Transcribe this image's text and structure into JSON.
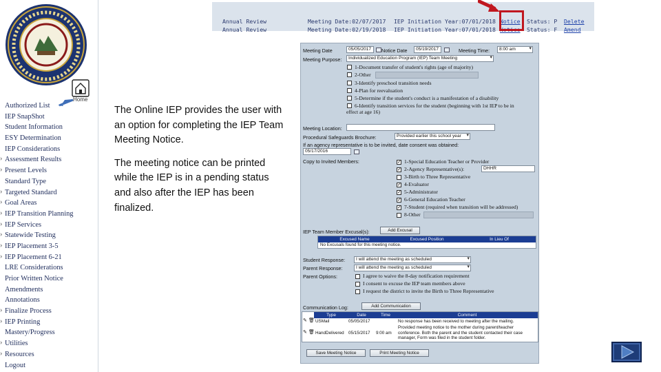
{
  "sidebar": {
    "home_label": "Home",
    "items": [
      {
        "label": "Authorized List",
        "arrow": false
      },
      {
        "label": "IEP SnapShot",
        "arrow": false
      },
      {
        "label": "Student Information",
        "arrow": false
      },
      {
        "label": "ESY Determination",
        "arrow": false
      },
      {
        "label": "IEP Considerations",
        "arrow": false
      },
      {
        "label": "Assessment Results",
        "arrow": true
      },
      {
        "label": "Present Levels",
        "arrow": true
      },
      {
        "label": "Standard Type",
        "arrow": false
      },
      {
        "label": "Targeted Standard",
        "arrow": true
      },
      {
        "label": "Goal Areas",
        "arrow": true
      },
      {
        "label": "IEP Transition Planning",
        "arrow": true
      },
      {
        "label": "IEP Services",
        "arrow": true
      },
      {
        "label": "Statewide Testing",
        "arrow": true
      },
      {
        "label": "IEP Placement 3-5",
        "arrow": true
      },
      {
        "label": "IEP Placement 6-21",
        "arrow": true
      },
      {
        "label": "LRE Considerations",
        "arrow": false
      },
      {
        "label": "Prior Written Notice",
        "arrow": false
      },
      {
        "label": "Amendments",
        "arrow": false
      },
      {
        "label": "Annotations",
        "arrow": false
      },
      {
        "label": "Finalize Process",
        "arrow": true
      },
      {
        "label": "IEP Printing",
        "arrow": true
      },
      {
        "label": "Mastery/Progress",
        "arrow": false
      },
      {
        "label": "Utilities",
        "arrow": true
      },
      {
        "label": "Resources",
        "arrow": true
      },
      {
        "label": "Logout",
        "arrow": false
      }
    ]
  },
  "description": {
    "para1": "The Online IEP provides the user with an option for completing the IEP Team Meeting Notice.",
    "para2": "The meeting notice  can be printed while the IEP is in a pending status and also after the IEP has been finalized."
  },
  "meetings": [
    {
      "type": "Annual Review",
      "date": "Meeting Date:02/07/2017",
      "year": "IEP Initiation Year:07/01/2018",
      "notice": "Notice",
      "status": "Status: P",
      "action": "Delete"
    },
    {
      "type": "Annual Review",
      "date": "Meeting Date:02/19/2018",
      "year": "IEP Initiation Year:07/01/2018",
      "notice": "Notice",
      "status": "Status: F",
      "action": "Amend"
    }
  ],
  "form": {
    "meeting_date_label": "Meeting Date",
    "meeting_date_value": "05/05/2017",
    "notice_date_label": "Notice Date",
    "notice_date_value": "05/19/2017",
    "meeting_time_label": "Meeting Time:",
    "meeting_time_value": "8:00 am",
    "purpose_label": "Meeting Purpose:",
    "purpose_value": "Individualized Education Program (IEP) Team Meeting",
    "purposes": [
      {
        "text": "1-Document transfer of student's rights (age of majority)"
      },
      {
        "text": "2-Other"
      },
      {
        "text": "3-Identify preschool transition needs"
      },
      {
        "text": "4-Plan for reevaluation"
      },
      {
        "text": "5-Determine if the student's conduct is a manifestation of a disability"
      },
      {
        "text": "6-Identify transition services for the student (beginning with 1st IEP to be in"
      },
      {
        "text": "effect at age 16)"
      }
    ],
    "location_label": "Meeting Location:",
    "safeguards_label": "Procedural Safeguards Brochure:",
    "safeguards_value": "Provided earlier this school year",
    "agency_label": "If an agency representative is to be invited, date consent was obtained:",
    "agency_date": "05/17/2016",
    "copy_label": "Copy to Invited Members:",
    "members": [
      {
        "text": "1-Special Education Teacher or Provider",
        "checked": true
      },
      {
        "text": "2-Agency Representative(s):",
        "checked": true,
        "value": "DHHR"
      },
      {
        "text": "3-Birth to Three Representative",
        "checked": false
      },
      {
        "text": "4-Evaluator",
        "checked": true
      },
      {
        "text": "5-Administrator",
        "checked": true
      },
      {
        "text": "6-General Education Teacher",
        "checked": true
      },
      {
        "text": "7-Student (required when transition will be addressed)",
        "checked": true
      },
      {
        "text": "8-Other",
        "checked": false
      }
    ],
    "excusal_label": "IEP Team Member Excusal(s):",
    "add_excusal": "Add Excusal",
    "excusal_headers": [
      "Excused Name",
      "Excused Position",
      "In Lieu Of"
    ],
    "excusal_empty": "No Excusals found for this meeting notice.",
    "student_response_label": "Student Response:",
    "student_response_value": "I will attend the meeting as scheduled",
    "parent_response_label": "Parent Response:",
    "parent_response_value": "I will attend the meeting as scheduled",
    "parent_options_label": "Parent Options:",
    "parent_options": [
      {
        "text": "I agree to waive the 8-day notification requirement"
      },
      {
        "text": "I consent to excuse the IEP team members above"
      },
      {
        "text": "I request the district to invite the Birth to Three Representative"
      }
    ],
    "comm_label": "Communication Log:",
    "add_comm": "Add Communication",
    "comm_headers": [
      "Type",
      "Date",
      "Time",
      "Comment"
    ],
    "comm_rows": [
      {
        "type": "USMail",
        "date": "05/05/2017",
        "time": "",
        "comment": "No response has been received to meeting after the mailing."
      },
      {
        "type": "HandDelivered",
        "date": "05/15/2017",
        "time": "9:00 am",
        "comment": "Provided meeting notice to the mother during parent/teacher conference. Both the parent and the student contacted their case manager, Form was filed in the student folder."
      }
    ],
    "save_btn": "Save Meeting Notice",
    "print_btn": "Print Meeting Notice"
  },
  "colors": {
    "header_blue": "#1b3d93",
    "form_bg": "#c7d3df",
    "highlight_red": "#c0171f",
    "nav_text": "#1f2d5c"
  }
}
